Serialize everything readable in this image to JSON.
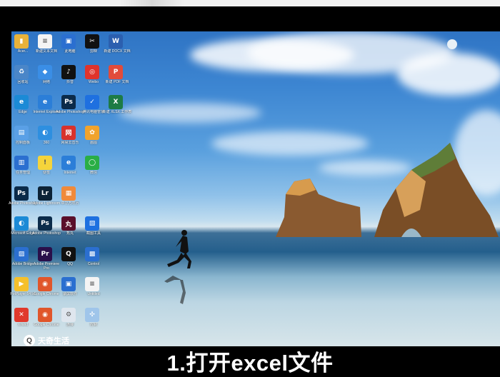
{
  "desktop": {
    "icons": [
      {
        "label": "Acer...",
        "color": "#e8b23a",
        "glyph": "▮",
        "icon": "folder-icon"
      },
      {
        "label": "新建文本文档",
        "color": "#f4f4f4",
        "glyph": "≡",
        "icon": "document-icon"
      },
      {
        "label": "此电脑",
        "color": "#2b6fd0",
        "glyph": "▣",
        "icon": "computer-icon"
      },
      {
        "label": "剪映",
        "color": "#111111",
        "glyph": "✂",
        "icon": "capcut-icon"
      },
      {
        "label": "新建 DOCX 文档",
        "color": "#2b5faf",
        "glyph": "W",
        "icon": "word-icon"
      },
      {
        "label": "回收站",
        "color": "#4a86c8",
        "glyph": "♻",
        "icon": "recycle-bin-icon"
      },
      {
        "label": "网络",
        "color": "#3a8ee6",
        "glyph": "◆",
        "icon": "network-icon"
      },
      {
        "label": "抖音",
        "color": "#111111",
        "glyph": "♪",
        "icon": "douyin-icon"
      },
      {
        "label": "Weibo",
        "color": "#e0332c",
        "glyph": "◎",
        "icon": "weibo-icon"
      },
      {
        "label": "新建 PDF 文档",
        "color": "#e14b3b",
        "glyph": "P",
        "icon": "pdf-icon"
      },
      {
        "label": "Edge",
        "color": "#1b8ad6",
        "glyph": "e",
        "icon": "edge-icon"
      },
      {
        "label": "Internet Explorer",
        "color": "#2b7ed8",
        "glyph": "e",
        "icon": "ie-icon"
      },
      {
        "label": "Adobe Photoshop",
        "color": "#0b2b4a",
        "glyph": "Ps",
        "icon": "photoshop-icon"
      },
      {
        "label": "腾讯电脑管家",
        "color": "#1e70e0",
        "glyph": "✓",
        "icon": "security-icon"
      },
      {
        "label": "新建 XLSX 工作表",
        "color": "#1d7b45",
        "glyph": "X",
        "icon": "excel-icon"
      },
      {
        "label": "控制面板",
        "color": "#5aa0e6",
        "glyph": "▤",
        "icon": "control-panel-icon"
      },
      {
        "label": "360",
        "color": "#2e8fe0",
        "glyph": "◐",
        "icon": "search-app-icon"
      },
      {
        "label": "网易云音乐",
        "color": "#d8322c",
        "glyph": "网",
        "icon": "music-icon"
      },
      {
        "label": "画图",
        "color": "#f1a32c",
        "glyph": "✿",
        "icon": "paint-icon"
      },
      {
        "label": "",
        "color": "",
        "glyph": "",
        "icon": ""
      },
      {
        "label": "任务管理",
        "color": "#2b6fd0",
        "glyph": "▥",
        "icon": "monitor-icon"
      },
      {
        "label": "便签",
        "color": "#f5d43b",
        "glyph": "!",
        "icon": "note-icon"
      },
      {
        "label": "Internet",
        "color": "#2b7ed8",
        "glyph": "e",
        "icon": "browser-icon"
      },
      {
        "label": "微信",
        "color": "#2aae45",
        "glyph": "◯",
        "icon": "wechat-icon"
      },
      {
        "label": "",
        "color": "",
        "glyph": "",
        "icon": ""
      },
      {
        "label": "Adobe Photoshop",
        "color": "#0b2b4a",
        "glyph": "Ps",
        "icon": "photoshop-icon"
      },
      {
        "label": "Adobe Lightroom",
        "color": "#0c2236",
        "glyph": "Lr",
        "icon": "lightroom-icon"
      },
      {
        "label": "中华万年历",
        "color": "#f08a3b",
        "glyph": "▦",
        "icon": "calendar-icon"
      },
      {
        "label": "",
        "color": "",
        "glyph": "",
        "icon": ""
      },
      {
        "label": "",
        "color": "",
        "glyph": "",
        "icon": ""
      },
      {
        "label": "Microsoft Edge",
        "color": "#1b8ad6",
        "glyph": "◐",
        "icon": "edge-icon"
      },
      {
        "label": "Adobe Photoshop",
        "color": "#0b2b4a",
        "glyph": "Ps",
        "icon": "photoshop-icon"
      },
      {
        "label": "秀丸",
        "color": "#5a0f2a",
        "glyph": "丸",
        "icon": "editor-icon"
      },
      {
        "label": "截图工具",
        "color": "#1e70e0",
        "glyph": "▧",
        "icon": "snip-icon"
      },
      {
        "label": "",
        "color": "",
        "glyph": "",
        "icon": ""
      },
      {
        "label": "Adobe Bridge",
        "color": "#2b6fd0",
        "glyph": "▨",
        "icon": "bridge-icon"
      },
      {
        "label": "Adobe Premiere Pro",
        "color": "#2a0f4a",
        "glyph": "Pr",
        "icon": "premiere-icon"
      },
      {
        "label": "QQ",
        "color": "#111111",
        "glyph": "Q",
        "icon": "qq-icon"
      },
      {
        "label": "Control",
        "color": "#2b6fd0",
        "glyph": "▩",
        "icon": "settings-icon"
      },
      {
        "label": "",
        "color": "",
        "glyph": "",
        "icon": ""
      },
      {
        "label": "PotPlayer 64 bit",
        "color": "#f5c02b",
        "glyph": "▶",
        "icon": "player-icon"
      },
      {
        "label": "Google Chrome",
        "color": "#e0562b",
        "glyph": "◉",
        "icon": "chrome-icon"
      },
      {
        "label": "录屏软件",
        "color": "#2b6fd0",
        "glyph": "▣",
        "icon": "recorder-icon"
      },
      {
        "label": "Untitled",
        "color": "#f4f4f4",
        "glyph": "≡",
        "icon": "text-file-icon"
      },
      {
        "label": "",
        "color": "",
        "glyph": "",
        "icon": ""
      },
      {
        "label": "Xmind",
        "color": "#e0392c",
        "glyph": "✕",
        "icon": "xmind-icon"
      },
      {
        "label": "Google Chrome",
        "color": "#e0562b",
        "glyph": "◉",
        "icon": "chrome-icon"
      },
      {
        "label": "连接",
        "color": "#dfe6ee",
        "glyph": "⚙",
        "icon": "gear-icon"
      },
      {
        "label": "控制",
        "color": "#9fc5ea",
        "glyph": "✣",
        "icon": "app-icon"
      }
    ]
  },
  "watermark": {
    "text": "天奇生活",
    "icon": "brand-logo-icon"
  },
  "caption": "1.打开excel文件"
}
